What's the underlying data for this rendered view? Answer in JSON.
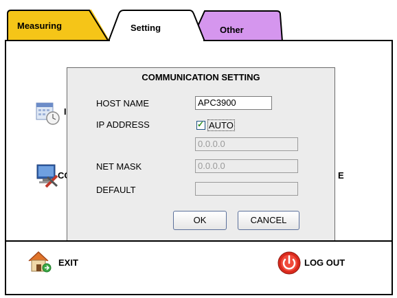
{
  "tabs": [
    {
      "label": "Measuring",
      "color": "#f5c518"
    },
    {
      "label": "Setting",
      "color": "#ffffff"
    },
    {
      "label": "Other",
      "color": "#d596ee"
    }
  ],
  "panel": {
    "item_partial_1": "I",
    "item_partial_2": "CO",
    "item_partial_3": "E"
  },
  "dialog": {
    "title": "COMMUNICATION SETTING",
    "host_name_label": "HOST NAME",
    "host_name_value": "APC3900",
    "ip_address_label": "IP ADDRESS",
    "auto_label": "AUTO",
    "auto_checked": true,
    "ip_value": "0.0.0.0",
    "net_mask_label": "NET MASK",
    "net_mask_value": "0.0.0.0",
    "default_label": "DEFAULT",
    "default_value": "",
    "ok_label": "OK",
    "cancel_label": "CANCEL"
  },
  "footer": {
    "exit_label": "EXIT",
    "logout_label": "LOG OUT"
  },
  "icons": {
    "calendar": "calendar-clock-icon",
    "computer": "computer-tools-icon",
    "home": "home-exit-icon",
    "power": "power-icon"
  }
}
